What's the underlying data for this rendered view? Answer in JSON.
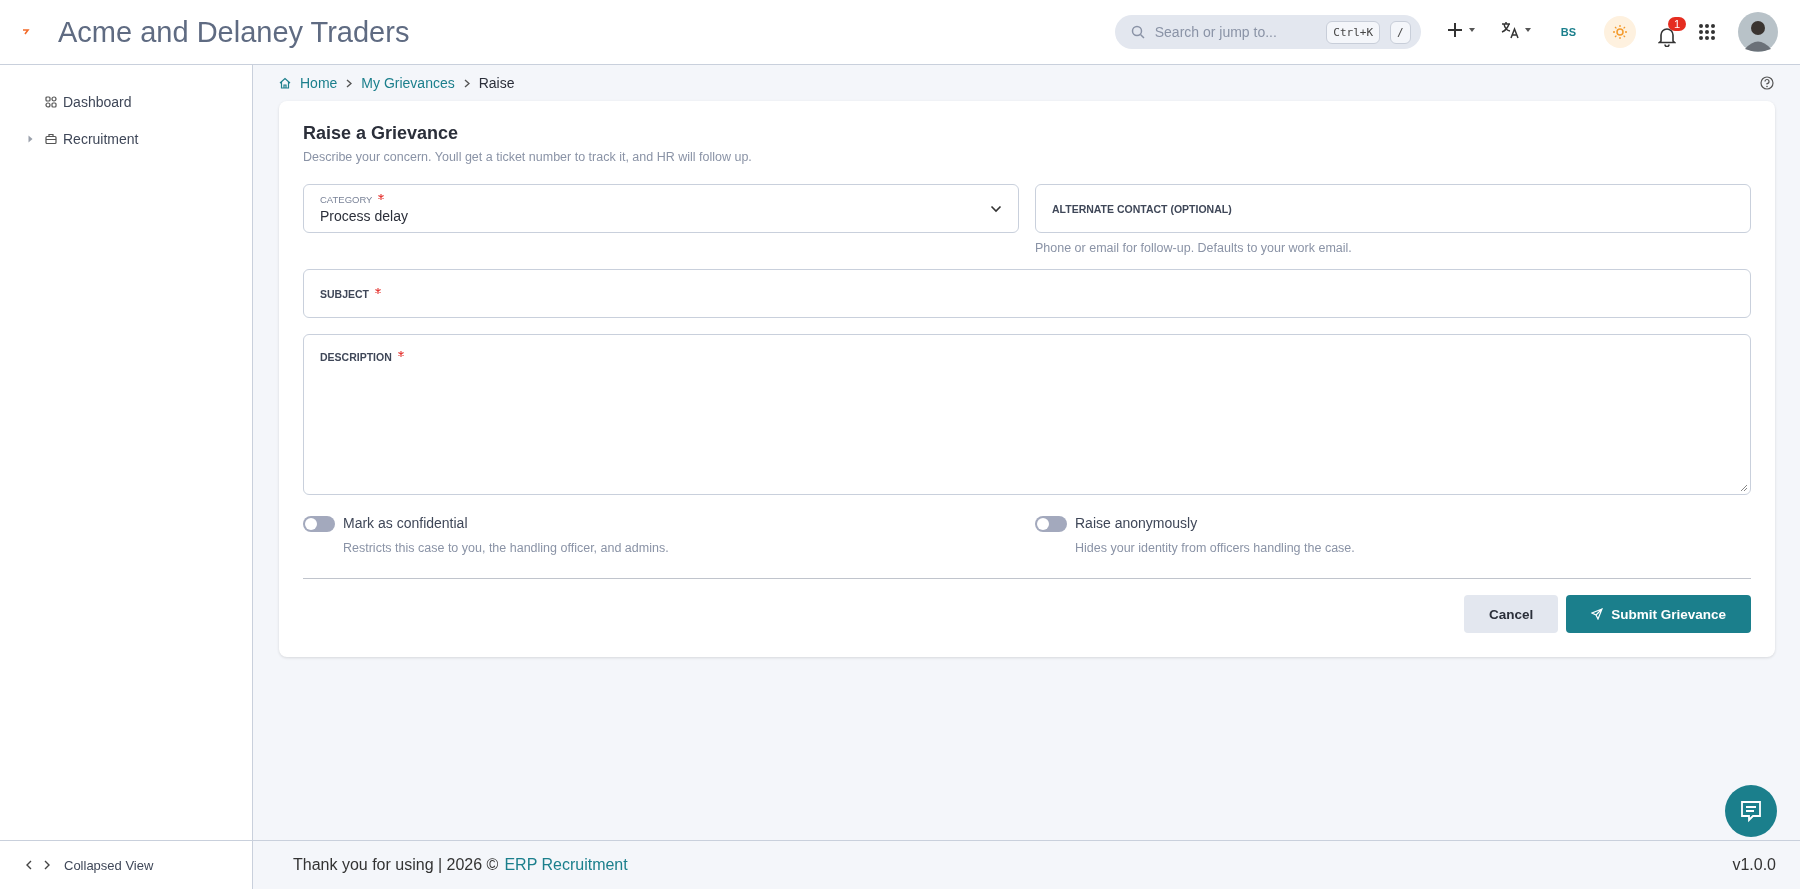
{
  "header": {
    "title": "Acme and Delaney Traders",
    "search": {
      "placeholder": "Search or jump to...",
      "keys": [
        "Ctrl+K",
        "/"
      ]
    },
    "initials": "BS",
    "notifications": "1"
  },
  "sidebar": {
    "items": [
      {
        "label": "Dashboard",
        "kind": "grid",
        "expandable": false
      },
      {
        "label": "Recruitment",
        "kind": "briefcase",
        "expandable": true
      }
    ],
    "footer": "Collapsed View"
  },
  "breadcrumb": [
    "Home",
    "My Grievances",
    "Raise"
  ],
  "form": {
    "title": "Raise a Grievance",
    "subtitle": "Describe your concern. Youll get a ticket number to track it, and HR will follow up.",
    "fields": [
      {
        "kind": "select",
        "label": "CATEGORY",
        "required": true,
        "value": "Process delay"
      },
      {
        "kind": "text",
        "label": "ALTERNATE CONTACT (OPTIONAL)",
        "required": false,
        "hint": "Phone or email for follow-up. Defaults to your work email."
      },
      {
        "kind": "text",
        "label": "SUBJECT",
        "required": true
      },
      {
        "kind": "textarea",
        "label": "DESCRIPTION",
        "required": true
      }
    ],
    "toggles": [
      {
        "label": "Mark as confidential",
        "description": "Restricts this case to you, the handling officer, and admins.",
        "on": false
      },
      {
        "label": "Raise anonymously",
        "description": "Hides your identity from officers handling the case.",
        "on": false
      }
    ],
    "buttons": [
      {
        "label": "Cancel",
        "kind": "secondary"
      },
      {
        "label": "Submit Grievance",
        "kind": "primary"
      }
    ]
  },
  "footer": {
    "text": "Thank you for using | 2026 ©",
    "link": "ERP Recruitment",
    "version": "v1.0.0"
  }
}
